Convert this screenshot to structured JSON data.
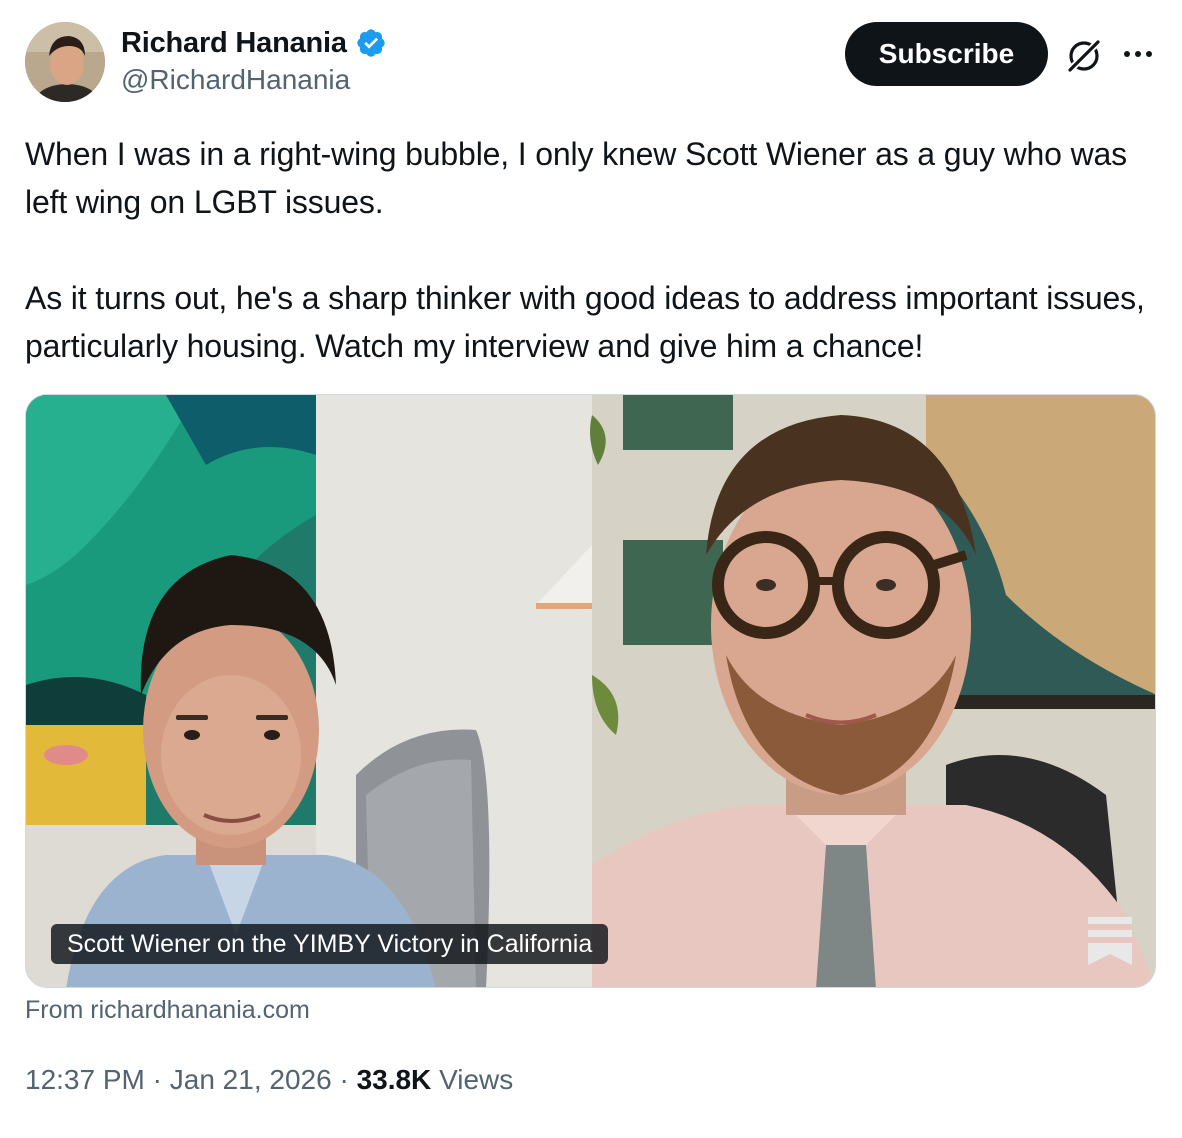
{
  "author": {
    "display_name": "Richard Hanania",
    "handle": "@RichardHanania",
    "verified": true
  },
  "header": {
    "subscribe_label": "Subscribe",
    "icons": [
      "grok-icon",
      "more-options-icon"
    ]
  },
  "tweet": {
    "paragraphs": [
      "When I was in a right-wing bubble, I only knew Scott Wiener as a guy who was left wing on LGBT issues.",
      "As it turns out, he's a sharp thinker with good ideas to address important issues, particularly housing. Watch my interview and give him a chance!"
    ]
  },
  "media": {
    "caption": "Scott Wiener on the YIMBY Victory in California",
    "source": "From richardhanania.com",
    "icon": "substack-bookmark-icon"
  },
  "meta": {
    "time": "12:37 PM",
    "separator": " · ",
    "date": "Jan 21, 2026",
    "views_count": "33.8K",
    "views_label": "Views"
  },
  "colors": {
    "text_primary": "#0f1419",
    "text_secondary": "#536471",
    "verified_blue": "#1d9bf0",
    "button_dark": "#0f1419",
    "border": "#cfd9de"
  }
}
